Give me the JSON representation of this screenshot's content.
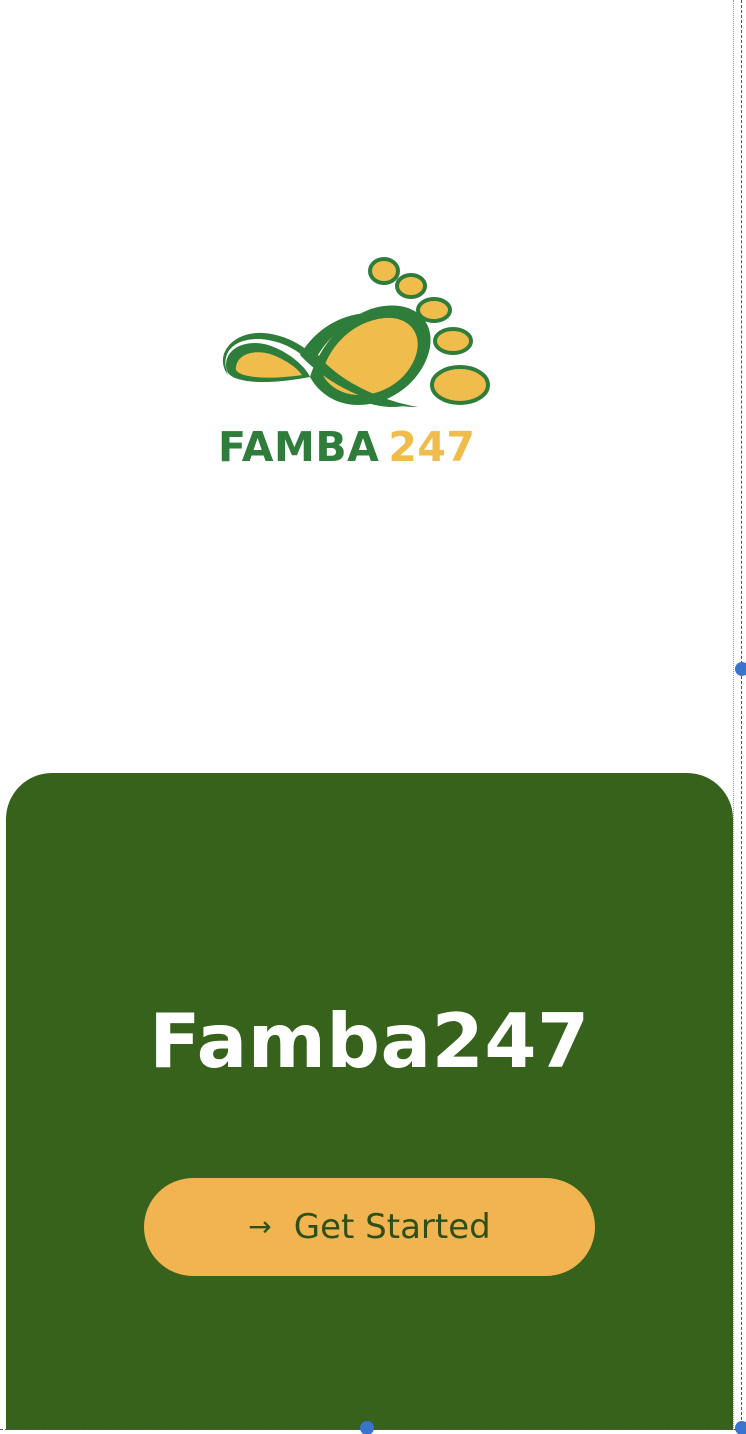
{
  "logo": {
    "word": "FAMBA",
    "number": "247",
    "icon": "footprint-icon",
    "colors": {
      "green": "#2e7d3a",
      "gold": "#f0bc4c"
    }
  },
  "panel": {
    "title": "Famba247",
    "background_color": "#37621b",
    "cta": {
      "label": "Get Started",
      "icon": "arrow-right-icon",
      "color": "#f2b451"
    }
  }
}
